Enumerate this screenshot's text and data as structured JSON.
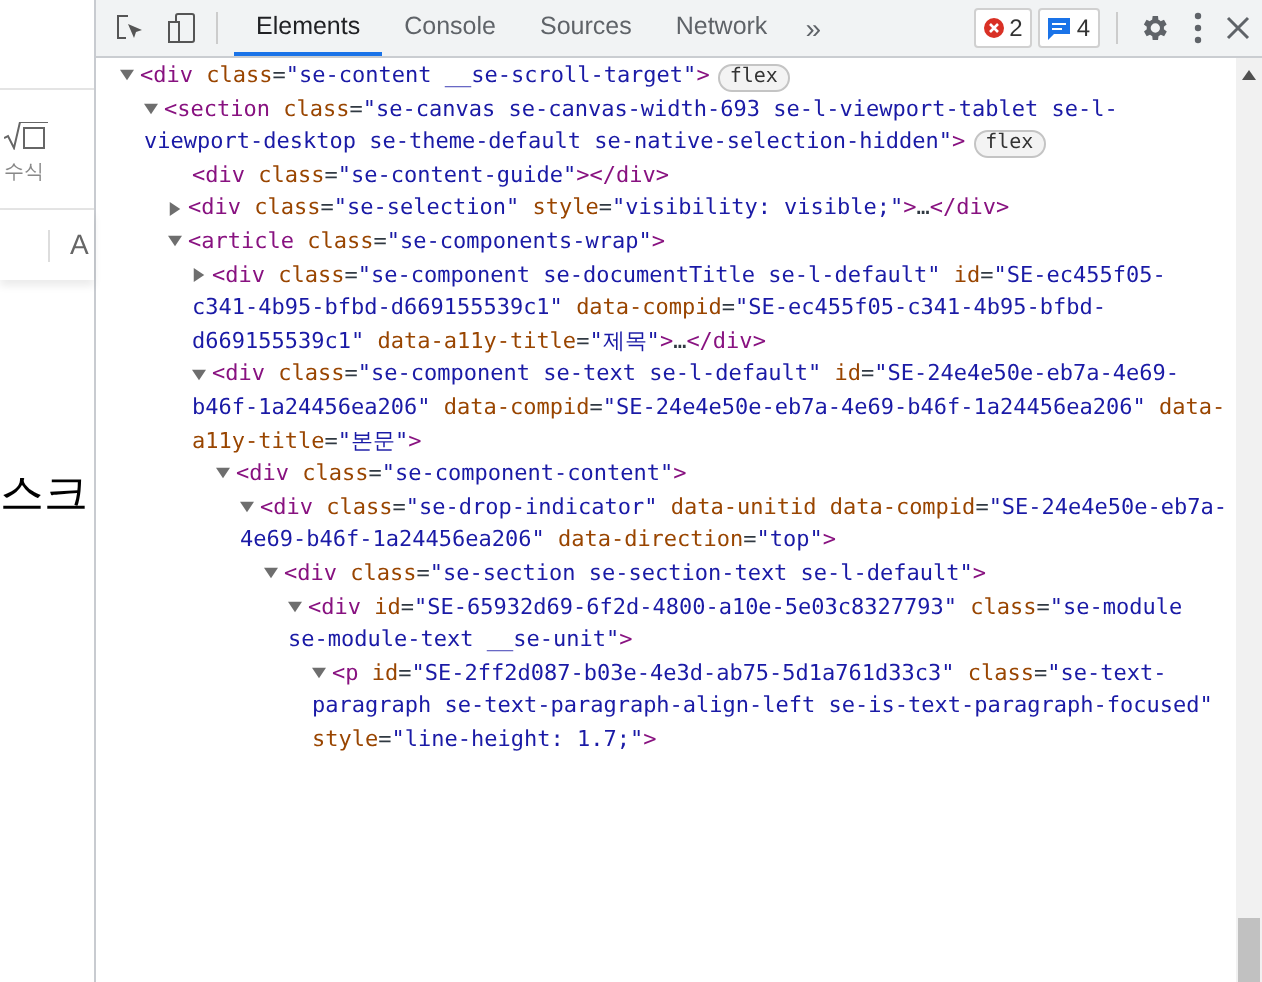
{
  "page": {
    "toolbar_label": "수식",
    "toolbar_row": [
      "A"
    ],
    "document_text": "스크"
  },
  "devtools": {
    "tabs": [
      {
        "label": "Elements",
        "selected": true
      },
      {
        "label": "Console",
        "selected": false
      },
      {
        "label": "Sources",
        "selected": false
      },
      {
        "label": "Network",
        "selected": false
      }
    ],
    "more_tabs": "»",
    "errors": "2",
    "messages": "4",
    "tree": [
      {
        "kind": "toggle",
        "expanded": true,
        "text": "<div class=\"se-content __se-scroll-target\">",
        "badge": "flex",
        "children": [
          {
            "kind": "toggle",
            "expanded": true,
            "text": "<section class=\"se-canvas se-canvas-width-693 se-l-viewport-tablet se-l-viewport-desktop se-theme-default se-native-selection-hidden\">",
            "badge": "flex",
            "children": [
              {
                "kind": "leaf",
                "text": "<div class=\"se-content-guide\"></div>"
              },
              {
                "kind": "toggle",
                "expanded": false,
                "text": "<div class=\"se-selection\" style=\"visibility: visible;\">…</div>"
              },
              {
                "kind": "toggle",
                "expanded": true,
                "text": "<article class=\"se-components-wrap\">",
                "children": [
                  {
                    "kind": "toggle",
                    "expanded": false,
                    "text": "<div class=\"se-component se-documentTitle se-l-default\" id=\"SE-ec455f05-c341-4b95-bfbd-d669155539c1\" data-compid=\"SE-ec455f05-c341-4b95-bfbd-d669155539c1\" data-a11y-title=\"제목\">…</div>"
                  },
                  {
                    "kind": "toggle",
                    "expanded": true,
                    "text": "<div class=\"se-component se-text se-l-default\" id=\"SE-24e4e50e-eb7a-4e69-b46f-1a24456ea206\" data-compid=\"SE-24e4e50e-eb7a-4e69-b46f-1a24456ea206\" data-a11y-title=\"본문\">",
                    "children": [
                      {
                        "kind": "toggle",
                        "expanded": true,
                        "text": "<div class=\"se-component-content\">",
                        "children": [
                          {
                            "kind": "toggle",
                            "expanded": true,
                            "text": "<div class=\"se-drop-indicator\" data-unitid data-compid=\"SE-24e4e50e-eb7a-4e69-b46f-1a24456ea206\" data-direction=\"top\">",
                            "children": [
                              {
                                "kind": "toggle",
                                "expanded": true,
                                "text": "<div class=\"se-section se-section-text se-l-default\">",
                                "children": [
                                  {
                                    "kind": "toggle",
                                    "expanded": true,
                                    "text": "<div id=\"SE-65932d69-6f2d-4800-a10e-5e03c8327793\" class=\"se-module se-module-text __se-unit\">",
                                    "children": [
                                      {
                                        "kind": "toggle",
                                        "expanded": true,
                                        "text": "<p id=\"SE-2ff2d087-b03e-4e3d-ab75-5d1a761d33c3\" class=\"se-text-paragraph se-text-paragraph-align-left se-is-text-paragraph-focused\" style=\"line-height: 1.7;\">"
                                      }
                                    ]
                                  }
                                ]
                              }
                            ]
                          }
                        ]
                      }
                    ]
                  }
                ]
              }
            ]
          }
        ]
      }
    ]
  }
}
